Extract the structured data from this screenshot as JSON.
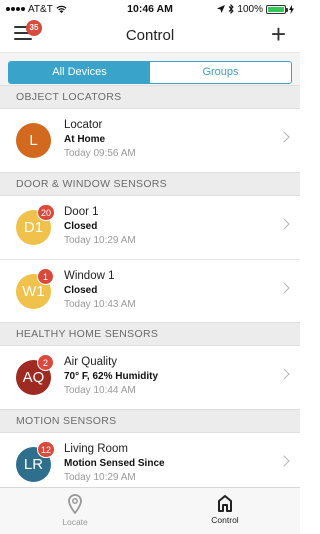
{
  "status_bar": {
    "carrier": "AT&T",
    "time": "10:46 AM",
    "battery": "100%",
    "battery_level": 1.0
  },
  "nav": {
    "title": "Control",
    "menu_badge": "35",
    "add_glyph": "+"
  },
  "segments": {
    "all_devices": "All Devices",
    "groups": "Groups",
    "selected": "All Devices"
  },
  "sections": [
    {
      "header": "OBJECT LOCATORS",
      "rows": [
        {
          "initials": "L",
          "name": "Locator",
          "status": "At Home",
          "time": "Today 09:56 AM",
          "color": "#d2691e",
          "badge": ""
        }
      ]
    },
    {
      "header": "DOOR & WINDOW SENSORS",
      "rows": [
        {
          "initials": "D1",
          "name": "Door 1",
          "status": "Closed",
          "time": "Today 10:29 AM",
          "color": "#f0c24b",
          "badge": "20"
        },
        {
          "initials": "W1",
          "name": "Window 1",
          "status": "Closed",
          "time": "Today 10:43 AM",
          "color": "#f0c24b",
          "badge": "1"
        }
      ]
    },
    {
      "header": "HEALTHY HOME SENSORS",
      "rows": [
        {
          "initials": "AQ",
          "name": "Air Quality",
          "status": "70° F, 62% Humidity",
          "time": "Today 10:44 AM",
          "color": "#9e2a22",
          "badge": "2"
        }
      ]
    },
    {
      "header": "MOTION SENSORS",
      "rows": [
        {
          "initials": "LR",
          "name": "Living Room",
          "status": "Motion Sensed Since",
          "time": "Today 10:29 AM",
          "color": "#2e6f8e",
          "badge": "12"
        }
      ]
    }
  ],
  "tabs": {
    "locate": "Locate",
    "control": "Control",
    "active": "Control"
  },
  "colors": {
    "accent": "#3aa3c9",
    "badge": "#d94a3d"
  }
}
